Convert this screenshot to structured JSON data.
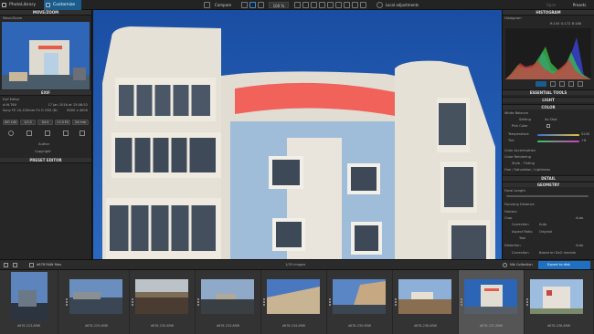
{
  "app": {
    "tabs": [
      {
        "label": "PhotoLibrary"
      },
      {
        "label": "Customize"
      }
    ],
    "compare_label": "Compare",
    "zoom_label": "100 %",
    "local_adjust_label": "Local adjustments",
    "open_label": "Open",
    "presets_label": "Presets"
  },
  "left_panel": {
    "movezoom_title": "MOVE/ZOOM",
    "movezoom_sub": "Move/Zoom",
    "exif_title": "EXIF",
    "exif_sub": "Exif Editor",
    "exif_filename": "d.fit.T60",
    "exif_date": "17 Jan 2016 at 15:08:52",
    "exif_camera": "Sony FE 24-105mm F4 G OSS (N)",
    "exif_size": "8000 x 4000",
    "exif_values": [
      "ISO 100",
      "1/2,5",
      "f/4.0",
      "+1.0 EV",
      "24 mm"
    ],
    "author_label": "Author",
    "copyright_label": "Copyright",
    "preset_title": "PRESET EDITOR"
  },
  "right_panel": {
    "histogram_title": "HISTOGRAM",
    "histogram_sub": "Histogram",
    "histogram_readout": "R:150 G:172 B:186",
    "essential_title": "ESSENTIAL TOOLS",
    "light_title": "LIGHT",
    "color_title": "COLOR",
    "wb_label": "White Balance",
    "setting_label": "Setting",
    "setting_value": "As Shot",
    "pick_label": "Pick Color",
    "temp_label": "Temperature",
    "temp_value": "5200",
    "tint_label": "Tint",
    "tint_value": "+6",
    "color_accent": "Color Accentuation",
    "color_render": "Color Rendering",
    "style_tinting": "Style - Tinting",
    "hue_sat": "Hue / Saturation / Lightness",
    "detail_title": "DETAIL",
    "geometry_title": "GEOMETRY",
    "focal_label": "Focal Length",
    "focusing_label": "Focusing Distance",
    "horizon_label": "Horizon",
    "crop_label": "Crop",
    "correction_label": "Correction",
    "correction_value": "Auto",
    "aspect_label": "Aspect Ratio",
    "aspect_value": "Original",
    "tool_label": "Tool",
    "distortion_label": "Distortion",
    "distortion_value": "Auto",
    "distortion_correction": "Based on DxO module"
  },
  "filmstrip": {
    "folder_label": "d678 RAW files",
    "count_label": "1/35 images",
    "nik_label": "Nik Collection",
    "export_label": "Export to disk",
    "items": [
      {
        "name": "d678-223.ARW"
      },
      {
        "name": "d678-229.ARW"
      },
      {
        "name": "d678-230.ARW"
      },
      {
        "name": "d678-233.ARW"
      },
      {
        "name": "d678-234.ARW"
      },
      {
        "name": "d678-235.ARW"
      },
      {
        "name": "d678-236.ARW"
      },
      {
        "name": "d678-237.ARW"
      },
      {
        "name": "d678-238.ARW"
      }
    ]
  },
  "colors": {
    "accent": "#1b5c8e",
    "sky": "#1e56a8",
    "export": "#1f70c0"
  }
}
